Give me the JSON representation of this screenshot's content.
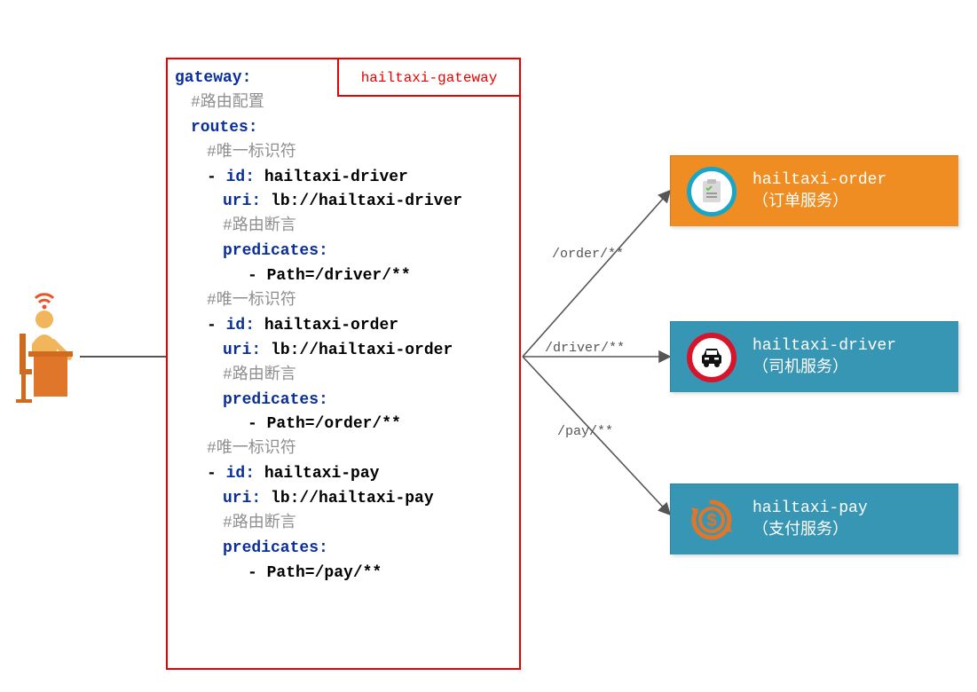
{
  "gateway_label": "hailtaxi-gateway",
  "config": {
    "line_gateway": "gateway:",
    "comment_route": "#路由配置",
    "line_routes": "routes:",
    "comment_id": "#唯一标识符",
    "comment_pred": "#路由断言",
    "line_predicates": "predicates:",
    "routes": [
      {
        "id_line": "- id: ",
        "id_val": "hailtaxi-driver",
        "uri_key": "uri: ",
        "uri_val": "lb://hailtaxi-driver",
        "path": "- Path=/driver/**"
      },
      {
        "id_line": "- id: ",
        "id_val": "hailtaxi-order",
        "uri_key": "uri: ",
        "uri_val": "lb://hailtaxi-order",
        "path": "- Path=/order/**"
      },
      {
        "id_line": "- id: ",
        "id_val": "hailtaxi-pay",
        "uri_key": "uri: ",
        "uri_val": "lb://hailtaxi-pay",
        "path": "- Path=/pay/**"
      }
    ]
  },
  "paths": {
    "order": "/order/**",
    "driver": "/driver/**",
    "pay": "/pay/**"
  },
  "services": {
    "order": {
      "name": "hailtaxi-order",
      "sub": "（订单服务）"
    },
    "driver": {
      "name": "hailtaxi-driver",
      "sub": "（司机服务）"
    },
    "pay": {
      "name": "hailtaxi-pay",
      "sub": "（支付服务）"
    }
  }
}
